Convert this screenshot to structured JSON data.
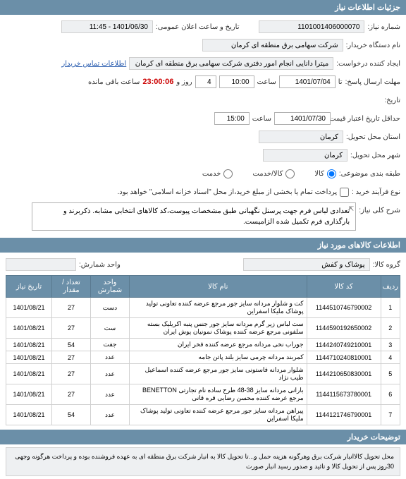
{
  "sections": {
    "need_info": "جزئیات اطلاعات نیاز",
    "goods_info": "اطلاعات کالاهای مورد نیاز",
    "notes": "توضیحات خریدار"
  },
  "form": {
    "need_number_label": "شماره نیاز:",
    "need_number": "1101001406000070",
    "announce_label": "تاریخ و ساعت اعلان عمومی:",
    "announce_value": "1401/06/30 - 11:45",
    "org_label": "نام دستگاه خریدار:",
    "org_value": "شرکت سهامی برق منطقه ای کرمان",
    "requester_label": "ایجاد کننده درخواست:",
    "requester_value": "میترا دانایی انجام امور دفتری شرکت سهامی برق منطقه ای کرمان",
    "contact_link": "اطلاعات تماس خریدار",
    "deadline_label": "مهلت ارسال پاسخ:",
    "deadline_label2": "تا",
    "deadline_date": "1401/07/04",
    "hour_label": "ساعت",
    "deadline_hour": "10:00",
    "day_label": "روز و",
    "days_remain": "4",
    "countdown": "23:00:06",
    "remain_label": "ساعت باقی مانده",
    "tarikh_label": "تاریخ:",
    "credit_label": "حداقل تاریخ اعتبار قیمت تا تاریخ:",
    "credit_date": "1401/07/30",
    "credit_hour": "15:00",
    "delivery_addr_label": "استان محل تحویل:",
    "delivery_addr": "کرمان",
    "delivery_city_label": "شهر محل تحویل:",
    "delivery_city": "کرمان",
    "category_label": "طبقه بندی موضوعی:",
    "cat_goods": "کالا",
    "cat_service": "کالا/خدمت",
    "cat_service2": "خدمت",
    "process_label": "نوع فرآیند خرید :",
    "process_note": "پرداخت تمام یا بخشی از مبلغ خرید،از محل \"اسناد خزانه اسلامی\" خواهد بود.",
    "desc_label": "شرح کلی نیاز:",
    "desc_text": "تعدادی لباس فرم جهت پرسنل نگهبانی طبق مشخصات پیوست،کد کالاهای انتخابی مشابه. ذکربرند و بارگذاری فرم تکمیل شده الزامیست.",
    "group_label": "گروه کالا:",
    "group_value": "پوشاک و کفش",
    "unit_label": "واحد شمارش:"
  },
  "table": {
    "headers": {
      "idx": "ردیف",
      "code": "کد کالا",
      "name": "نام کالا",
      "unit": "واحد شمارش",
      "qty": "تعداد / مقدار",
      "date": "تاریخ نیاز"
    },
    "rows": [
      {
        "idx": "1",
        "code": "1144510746790002",
        "name": "کت و شلوار مردانه سایز جور مرجع عرضه کننده تعاونی تولید پوشاک ملیکا اسفراین",
        "unit": "دست",
        "qty": "27",
        "date": "1401/08/21"
      },
      {
        "idx": "2",
        "code": "1144590192650002",
        "name": "ست لباس زیر گرم مردانه سایز جور جنس پنبه اکریلیک بسته سلفونی مرجع عرضه کننده پوشاک نمونیان پوش ایران",
        "unit": "ست",
        "qty": "27",
        "date": "1401/08/21"
      },
      {
        "idx": "3",
        "code": "1144240749210001",
        "name": "جوراب نخی مردانه مرجع عرضه کننده فخر ایران",
        "unit": "جفت",
        "qty": "54",
        "date": "1401/08/21"
      },
      {
        "idx": "4",
        "code": "1144710240810001",
        "name": "کمربند مردانه چرمی سایز بلند پاتن جامه",
        "unit": "عدد",
        "qty": "27",
        "date": "1401/08/21"
      },
      {
        "idx": "5",
        "code": "1144210650830001",
        "name": "شلوار مردانه فاستونی سایز جور مرجع عرضه کننده اسماعیل طیب نژاد",
        "unit": "عدد",
        "qty": "27",
        "date": "1401/08/21"
      },
      {
        "idx": "6",
        "code": "1144115673780001",
        "name": "بارانی مردانه سایز 38-48 طرح ساده نام تجارتی BENETTON مرجع عرضه کننده محسن رضایی قره قانی",
        "unit": "عدد",
        "qty": "27",
        "date": "1401/08/21"
      },
      {
        "idx": "7",
        "code": "1144121746790001",
        "name": "پیراهن مردانه سایز جور مرجع عرضه کننده تعاونی تولید پوشاک ملیکا اسفراین",
        "unit": "عدد",
        "qty": "54",
        "date": "1401/08/21"
      }
    ]
  },
  "footer": {
    "text": "محل تحویل کالاانبار شرکت برق وهرگونه هزینه حمل و...تا تحویل کالا به انبار شرکت برق منطقه ای به عهده فروشنده بوده و پرداخت هرگونه وجهی 30روز پس از تحویل کالا و تائید و صدور رسید انبار صورت"
  }
}
